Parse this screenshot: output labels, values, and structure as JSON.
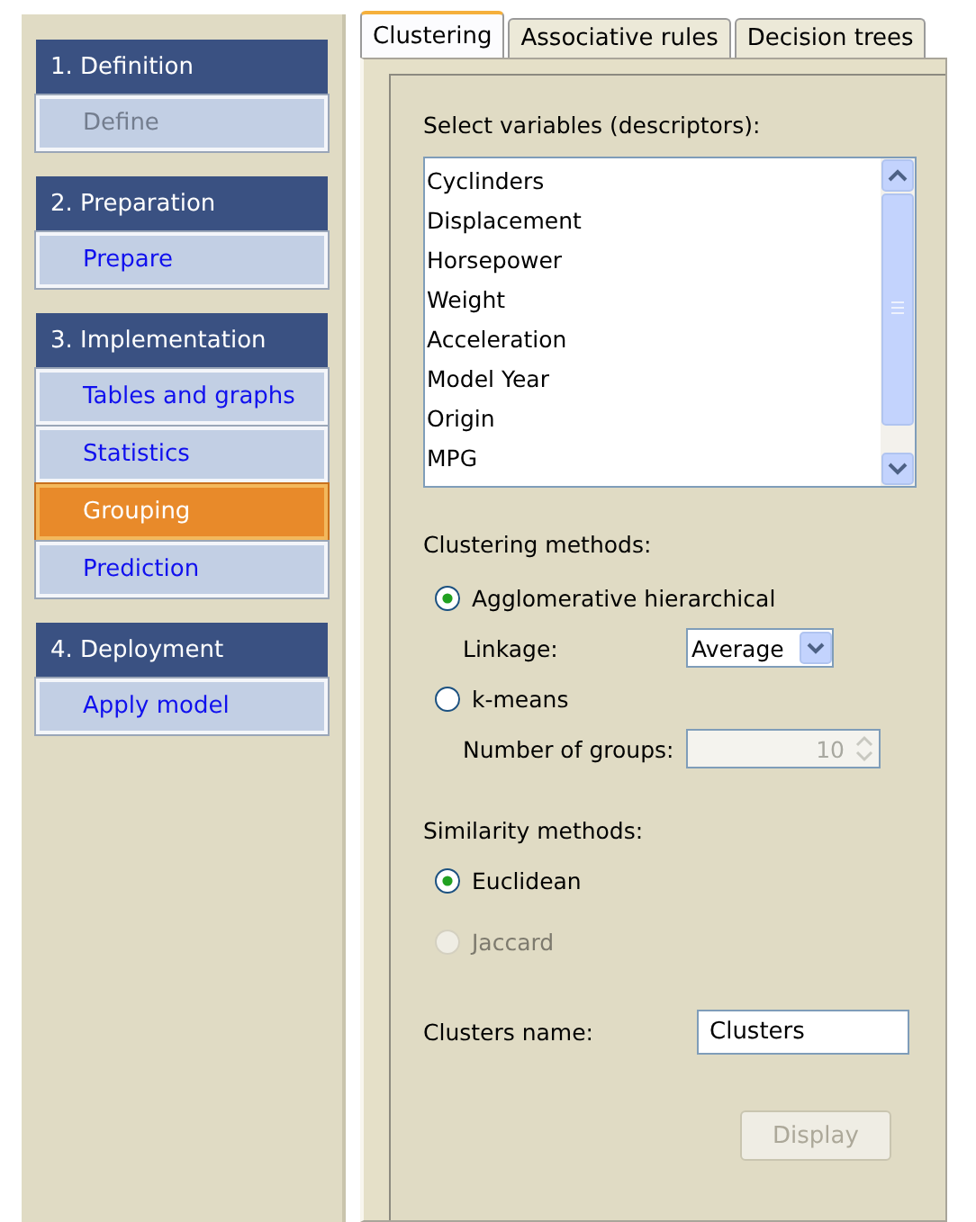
{
  "sidebar": {
    "sections": [
      {
        "title": "1. Definition",
        "items": [
          {
            "label": "Define",
            "disabled": true,
            "selected": false
          }
        ]
      },
      {
        "title": "2. Preparation",
        "items": [
          {
            "label": "Prepare",
            "disabled": false,
            "selected": false
          }
        ]
      },
      {
        "title": "3. Implementation",
        "items": [
          {
            "label": "Tables and graphs",
            "disabled": false,
            "selected": false
          },
          {
            "label": "Statistics",
            "disabled": false,
            "selected": false
          },
          {
            "label": "Grouping",
            "disabled": false,
            "selected": true
          },
          {
            "label": "Prediction",
            "disabled": false,
            "selected": false
          }
        ]
      },
      {
        "title": "4. Deployment",
        "items": [
          {
            "label": "Apply model",
            "disabled": false,
            "selected": false
          }
        ]
      }
    ]
  },
  "tabs": [
    {
      "label": "Clustering",
      "selected": true
    },
    {
      "label": "Associative rules",
      "selected": false
    },
    {
      "label": "Decision trees",
      "selected": false
    }
  ],
  "variables": {
    "label": "Select variables (descriptors):",
    "items": [
      "Cyclinders",
      "Displacement",
      "Horsepower",
      "Weight",
      "Acceleration",
      "Model Year",
      "Origin",
      "MPG"
    ]
  },
  "clustering_methods": {
    "label": "Clustering methods:",
    "agglomerative": {
      "label": "Agglomerative hierarchical",
      "checked": true,
      "disabled": false
    },
    "linkage": {
      "label": "Linkage:",
      "value": "Average"
    },
    "kmeans": {
      "label": "k-means",
      "checked": false,
      "disabled": false
    },
    "groups": {
      "label": "Number of groups:",
      "value": "10",
      "disabled": true
    }
  },
  "similarity_methods": {
    "label": "Similarity methods:",
    "options": [
      {
        "label": "Euclidean",
        "checked": true,
        "disabled": false
      },
      {
        "label": "Jaccard",
        "checked": false,
        "disabled": true
      }
    ]
  },
  "clusters_name": {
    "label": "Clusters name:",
    "value": "Clusters"
  },
  "display_button": {
    "label": "Display",
    "disabled": true
  }
}
